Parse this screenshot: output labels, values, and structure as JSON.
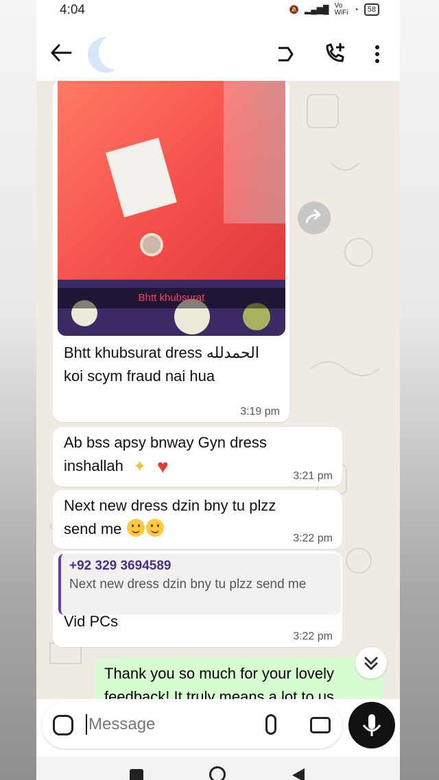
{
  "status_bar": {
    "time": "4:04",
    "network_label": "Vo\nWiFi",
    "battery": "58"
  },
  "header": {
    "back_icon": "arrow-left-icon",
    "video_icon": "video-call-icon",
    "call_icon": "call-add-icon",
    "more_icon": "more-vertical-icon"
  },
  "chat": {
    "image_message": {
      "caption_overlay": "Bhtt khubsurat",
      "text": "Bhtt khubsurat dress الحمدلله koi scym fraud nai hua",
      "time": "3:19 pm"
    },
    "messages": [
      {
        "text": "Ab bss apsy bnway Gyn dress inshallah",
        "time": "3:21 pm"
      },
      {
        "text": "Next new dress dzin  bny tu plzz send me",
        "time": "3:22 pm"
      }
    ],
    "reply_message": {
      "quoted_sender": "+92 329 3694589",
      "quoted_text": "Next new dress dzin  bny tu plzz  send me",
      "text": "Vid PCs",
      "time": "3:22 pm"
    },
    "outgoing_preview": "Thank you so much for your lovely feedback! It truly means a lot to us"
  },
  "composer": {
    "placeholder": "Message",
    "sticker_icon": "sticker-icon",
    "attach_icon": "paperclip-icon",
    "camera_icon": "camera-icon",
    "mic_icon": "microphone-icon"
  },
  "colors": {
    "chat_background": "#efeae2",
    "accent": "#6a3db8",
    "outgoing_bubble": "#d9fdd3"
  }
}
